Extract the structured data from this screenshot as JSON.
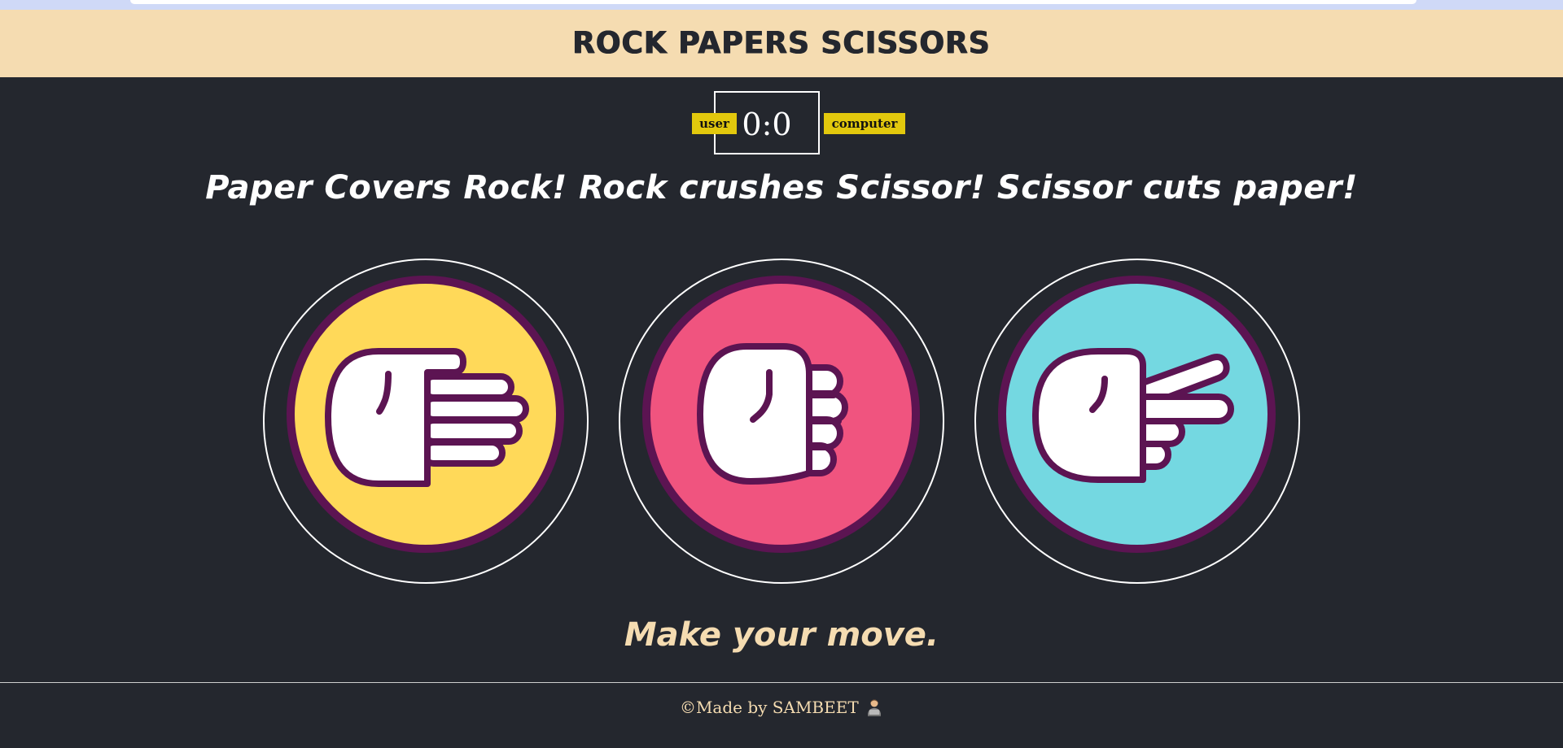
{
  "header": {
    "title": "ROCK PAPERS SCISSORS"
  },
  "scoreboard": {
    "user_label": "user",
    "computer_label": "computer",
    "score": "0:0"
  },
  "tagline": "Paper Covers Rock! Rock crushes Scissor! Scissor cuts paper!",
  "choices": [
    {
      "name": "paper",
      "icon": "paper-hand-icon",
      "color": "#ffd959"
    },
    {
      "name": "rock",
      "icon": "rock-hand-icon",
      "color": "#f0547f"
    },
    {
      "name": "scissors",
      "icon": "scissors-hand-icon",
      "color": "#74d8e1"
    }
  ],
  "colors": {
    "background": "#24272e",
    "header": "#f5dcb1",
    "badge": "#e2c80d",
    "outline": "#5c1452"
  },
  "message": "Make your move.",
  "footer": {
    "text": "©Made by SAMBEET",
    "icon": "technologist-icon"
  }
}
